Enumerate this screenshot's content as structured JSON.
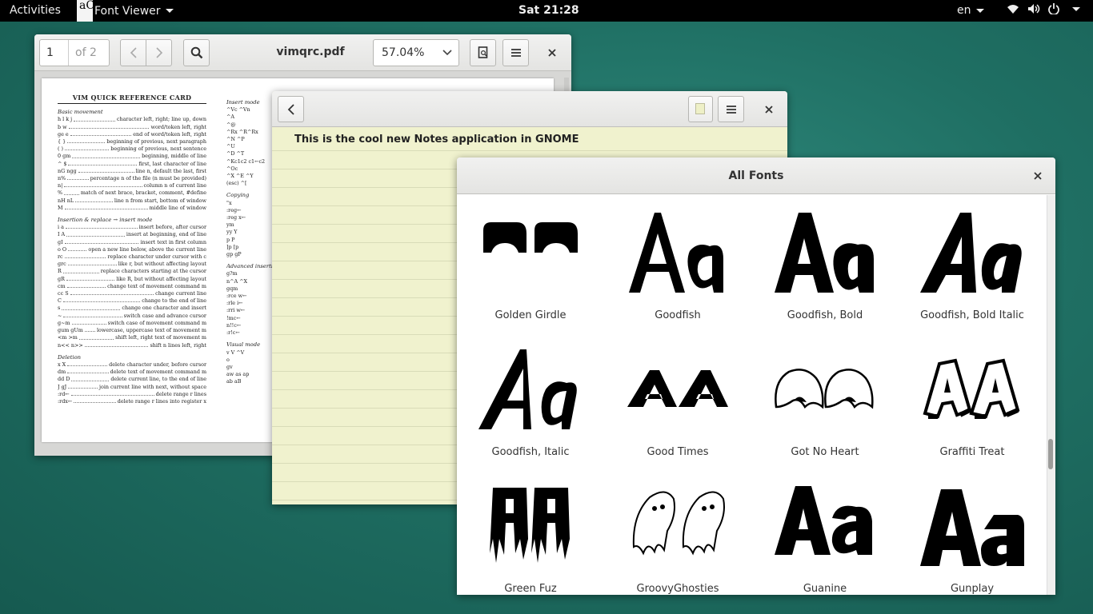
{
  "topbar": {
    "activities": "Activities",
    "app_name": "Font Viewer",
    "app_icon_text": "aC",
    "clock": "Sat 21:28",
    "language": "en"
  },
  "evince": {
    "page_current": "1",
    "page_total": "of 2",
    "title": "vimqrc.pdf",
    "zoom": "57.04%",
    "doc": {
      "title": "VIM QUICK REFERENCE CARD",
      "sections": [
        {
          "heading": "Basic movement",
          "lines": [
            [
              "h l k j",
              "character left, right; line up, down"
            ],
            [
              "b w",
              "word/token left, right"
            ],
            [
              "ge e",
              "end of word/token left, right"
            ],
            [
              "{ }",
              "beginning of previous, next paragraph"
            ],
            [
              "( )",
              "beginning of previous, next sentence"
            ],
            [
              "0 gm",
              "beginning, middle of line"
            ],
            [
              "^ $",
              "first, last character of line"
            ],
            [
              "nG ngg",
              "line n, default the last, first"
            ],
            [
              "n%",
              "percentage n of the file (n must be provided)"
            ],
            [
              "n|",
              "column n of current line"
            ],
            [
              "%",
              "match of next brace, bracket, comment, #define"
            ],
            [
              "nH nL",
              "line n from start, bottom of window"
            ],
            [
              "M",
              "middle line of window"
            ]
          ]
        },
        {
          "heading": "Insertion & replace → insert mode",
          "lines": [
            [
              "i a",
              "insert before, after cursor"
            ],
            [
              "I A",
              "insert at beginning, end of line"
            ],
            [
              "gI",
              "insert text in first column"
            ],
            [
              "o O",
              "open a new line below, above the current line"
            ],
            [
              "rc",
              "replace character under cursor with c"
            ],
            [
              "grc",
              "like r, but without affecting layout"
            ],
            [
              "R",
              "replace characters starting at the cursor"
            ],
            [
              "gR",
              "like R, but without affecting layout"
            ],
            [
              "cm",
              "change text of movement command m"
            ],
            [
              "cc S",
              "change current line"
            ],
            [
              "C",
              "change to the end of line"
            ],
            [
              "s",
              "change one character and insert"
            ],
            [
              "~",
              "switch case and advance cursor"
            ],
            [
              "g~m",
              "switch case of movement command m"
            ],
            [
              "gum gUm",
              "lowercase, uppercase text of movement m"
            ],
            [
              "<m >m",
              "shift left, right text of movement m"
            ],
            [
              "n<< n>>",
              "shift n lines left, right"
            ]
          ]
        },
        {
          "heading": "Deletion",
          "lines": [
            [
              "x X",
              "delete character under, before cursor"
            ],
            [
              "dm",
              "delete text of movement command m"
            ],
            [
              "dd D",
              "delete current line, to the end of line"
            ],
            [
              "J gJ",
              "join current line with next, without space"
            ],
            [
              ":rd←",
              "delete range r lines"
            ],
            [
              ":rdx←",
              "delete range r lines into register x"
            ]
          ]
        }
      ],
      "col2": [
        {
          "heading": "Insert mode",
          "lines": [
            "^Vc ^Vn",
            "^A",
            "^@",
            "^Rx ^R^Rx",
            "^N ^P",
            "^U",
            "^D ^T",
            "^Kc1c2 c1←c2",
            "^Oc",
            "^X ^E ^Y",
            "(esc) ^["
          ]
        },
        {
          "heading": "Copying",
          "lines": [
            "\"x",
            ":reg←",
            ":reg x←",
            "ym",
            "yy Y",
            "p P",
            "]p [p",
            "gp gP"
          ]
        },
        {
          "heading": "Advanced insertion",
          "lines": [
            "g?m",
            "n^A ^X",
            "gqm",
            ":rce w←",
            ":rle i←",
            ":rri w←",
            "!mc←",
            "n!!c←",
            ":r!c←"
          ]
        },
        {
          "heading": "Visual mode",
          "lines": [
            "v V ^V",
            "o",
            "gv",
            "aw as ap",
            "ab aB"
          ]
        }
      ]
    }
  },
  "notes": {
    "text": "This is the cool new Notes application in GNOME"
  },
  "fontviewer": {
    "title": "All Fonts",
    "fonts": [
      {
        "name": "Golden Girdle"
      },
      {
        "name": "Goodfish"
      },
      {
        "name": "Goodfish, Bold"
      },
      {
        "name": "Goodfish, Bold Italic"
      },
      {
        "name": "Goodfish, Italic"
      },
      {
        "name": "Good Times"
      },
      {
        "name": "Got No Heart"
      },
      {
        "name": "Graffiti Treat"
      },
      {
        "name": "Green Fuz"
      },
      {
        "name": "GroovyGhosties"
      },
      {
        "name": "Guanine"
      },
      {
        "name": "Gunplay"
      }
    ]
  }
}
